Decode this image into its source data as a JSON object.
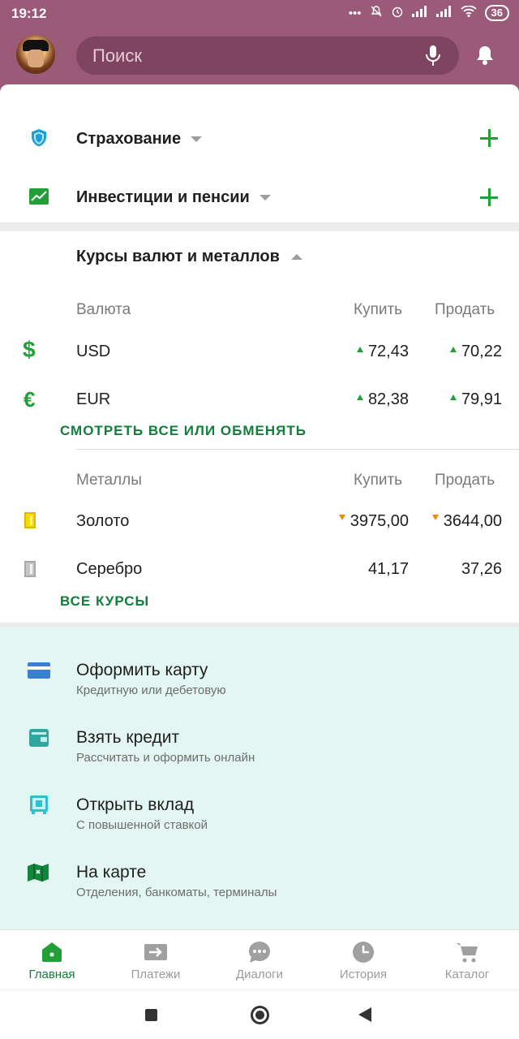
{
  "status": {
    "time": "19:12",
    "battery": "36"
  },
  "search": {
    "placeholder": "Поиск"
  },
  "sections": [
    {
      "label": "Страхование"
    },
    {
      "label": "Инвестиции и пенсии"
    }
  ],
  "rates": {
    "title": "Курсы валют и металлов",
    "currency_header": "Валюта",
    "buy_header": "Купить",
    "sell_header": "Продать",
    "currencies": [
      {
        "name": "USD",
        "buy": "72,43",
        "sell": "70,22",
        "trend": "up"
      },
      {
        "name": "EUR",
        "buy": "82,38",
        "sell": "79,91",
        "trend": "up"
      }
    ],
    "see_all_link": "СМОТРЕТЬ ВСЕ ИЛИ ОБМЕНЯТЬ",
    "metals_header": "Металлы",
    "metals": [
      {
        "name": "Золото",
        "buy": "3975,00",
        "sell": "3644,00",
        "trend": "down"
      },
      {
        "name": "Серебро",
        "buy": "41,17",
        "sell": "37,26",
        "trend": "none"
      }
    ],
    "all_rates_link": "ВСЕ КУРСЫ"
  },
  "actions": [
    {
      "title": "Оформить карту",
      "subtitle": "Кредитную или дебетовую",
      "icon": "card-icon"
    },
    {
      "title": "Взять кредит",
      "subtitle": "Рассчитать и оформить онлайн",
      "icon": "wallet-icon"
    },
    {
      "title": "Открыть вклад",
      "subtitle": "С повышенной ставкой",
      "icon": "safe-icon"
    },
    {
      "title": "На карте",
      "subtitle": "Отделения, банкоматы, терминалы",
      "icon": "map-icon"
    }
  ],
  "bottom_nav": [
    {
      "label": "Главная",
      "active": true
    },
    {
      "label": "Платежи",
      "active": false
    },
    {
      "label": "Диалоги",
      "active": false
    },
    {
      "label": "История",
      "active": false
    },
    {
      "label": "Каталог",
      "active": false
    }
  ],
  "colors": {
    "header": "#9b5a78",
    "accent_green": "#21a038",
    "link_green": "#107f3a",
    "actions_bg": "#e3f6f1",
    "trend_down": "#f08c00"
  }
}
